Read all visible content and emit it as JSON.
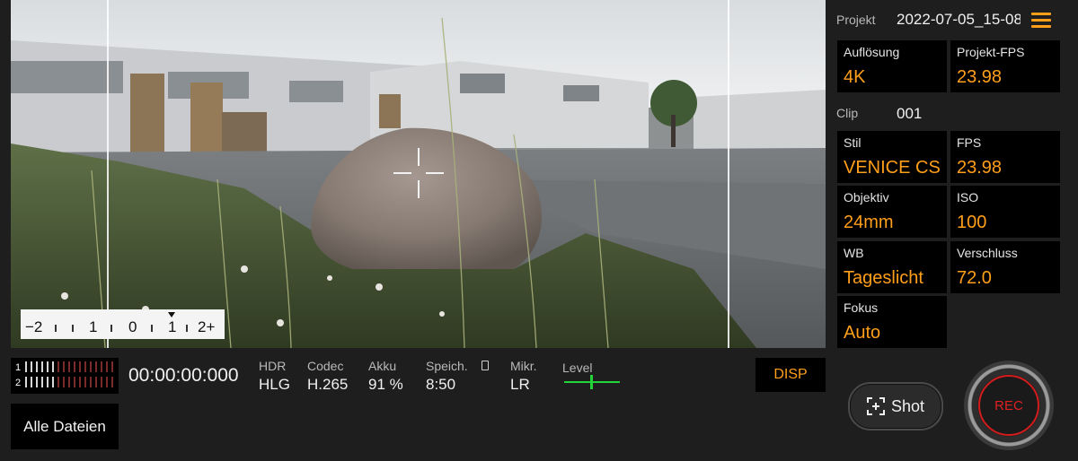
{
  "header": {
    "project_label": "Projekt",
    "project_name": "2022-07-05_15-08"
  },
  "settings": {
    "resolution": {
      "label": "Auflösung",
      "value": "4K"
    },
    "project_fps": {
      "label": "Projekt-FPS",
      "value": "23.98"
    },
    "clip": {
      "label": "Clip",
      "value": "001"
    },
    "style": {
      "label": "Stil",
      "value": "VENICE CS"
    },
    "fps": {
      "label": "FPS",
      "value": "23.98"
    },
    "lens": {
      "label": "Objektiv",
      "value": "24mm"
    },
    "iso": {
      "label": "ISO",
      "value": "100"
    },
    "wb": {
      "label": "WB",
      "value": "Tageslicht"
    },
    "shutter": {
      "label": "Verschluss",
      "value": "72.0"
    },
    "focus": {
      "label": "Fokus",
      "value": "Auto"
    }
  },
  "ev_scale": {
    "labels": [
      "−2",
      "1",
      "0",
      "1",
      "2+"
    ],
    "marker_value": 1.0
  },
  "audio_meter": {
    "channels": [
      "1",
      "2"
    ]
  },
  "status": {
    "timecode": "00:00:00:000",
    "hdr": {
      "label": "HDR",
      "value": "HLG"
    },
    "codec": {
      "label": "Codec",
      "value": "H.265"
    },
    "battery": {
      "label": "Akku",
      "value": "91 %"
    },
    "storage": {
      "label": "Speich.",
      "value": "8:50"
    },
    "mic": {
      "label": "Mikr.",
      "value": "LR"
    },
    "level_label": "Level"
  },
  "buttons": {
    "disp": "DISP",
    "all_files": "Alle Dateien",
    "shot": "Shot",
    "rec": "REC"
  },
  "icons": {
    "menu": "hamburger-menu-icon",
    "shot": "screenshot-frame-icon",
    "storage": "memory-card-icon"
  },
  "colors": {
    "accent": "#ff9f1a",
    "rec": "#e02020",
    "level": "#23d33a",
    "cell_bg": "#000000",
    "panel_bg": "#1e1e1e"
  }
}
